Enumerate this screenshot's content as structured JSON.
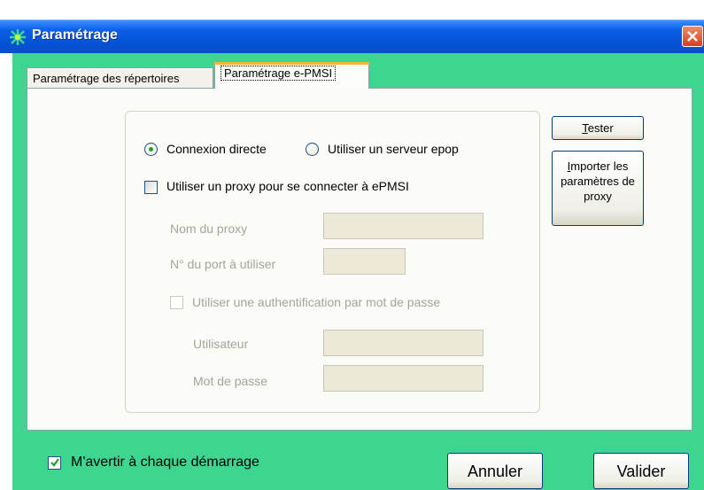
{
  "window": {
    "title": "Paramétrage"
  },
  "tabs": [
    {
      "label": "Paramétrage des répertoires"
    },
    {
      "label": "Paramétrage e-PMSI"
    }
  ],
  "connection": {
    "options": [
      {
        "label": "Connexion directe",
        "selected": true
      },
      {
        "label": "Utiliser un serveur epop",
        "selected": false
      }
    ]
  },
  "proxy": {
    "use_proxy_label": "Utiliser un proxy pour se connecter à ePMSI",
    "use_proxy_checked": false,
    "name_label": "Nom du proxy",
    "name_value": "",
    "port_label": "N° du port à utiliser",
    "port_value": "",
    "auth_label": "Utiliser une authentification par mot de passe",
    "auth_checked": false,
    "user_label": "Utilisateur",
    "user_value": "",
    "password_label": "Mot de passe",
    "password_value": ""
  },
  "buttons": {
    "tester_first": "T",
    "tester_rest": "ester",
    "import_first": "I",
    "import_line1_rest": "mporter les",
    "import_line2": "paramètres de",
    "import_line3": "proxy",
    "cancel": "Annuler",
    "validate": "Valider"
  },
  "footer": {
    "warn_label": "M'avertir à chaque démarrage",
    "warn_checked": true
  },
  "colors": {
    "window_bg": "#3dd58f",
    "titlebar": "#0553d6",
    "radio_dot": "#21a121"
  }
}
